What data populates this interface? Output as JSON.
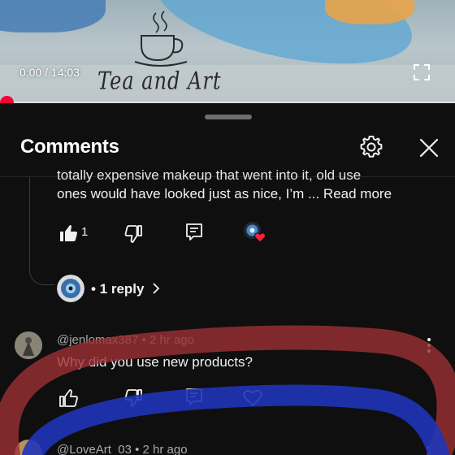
{
  "player": {
    "time": "0:00 / 14:03",
    "progress_fraction": 0,
    "watermark_text": "Tea and Art",
    "accent_color": "#ff0033"
  },
  "sheet": {
    "title": "Comments",
    "settings_icon": "gear-icon",
    "close_icon": "close-icon"
  },
  "reply_comment": {
    "cutoff_text": "totally expensive makeup that went into it, old use",
    "text": "ones would have looked just as nice, I’m ...",
    "read_more": "Read more",
    "likes": "1",
    "creator_heart": true
  },
  "replies_link": {
    "label": "• 1 reply"
  },
  "comments": [
    {
      "author": "@jenlomax387",
      "time": "• 2 hr ago",
      "text": "Why did you use new products?"
    },
    {
      "author": "@LoveArt_03",
      "time": "• 2 hr ago"
    }
  ],
  "annotations": {
    "red_scribble_color": "#9c2f35",
    "blue_scribble_color": "#1f34b8"
  }
}
